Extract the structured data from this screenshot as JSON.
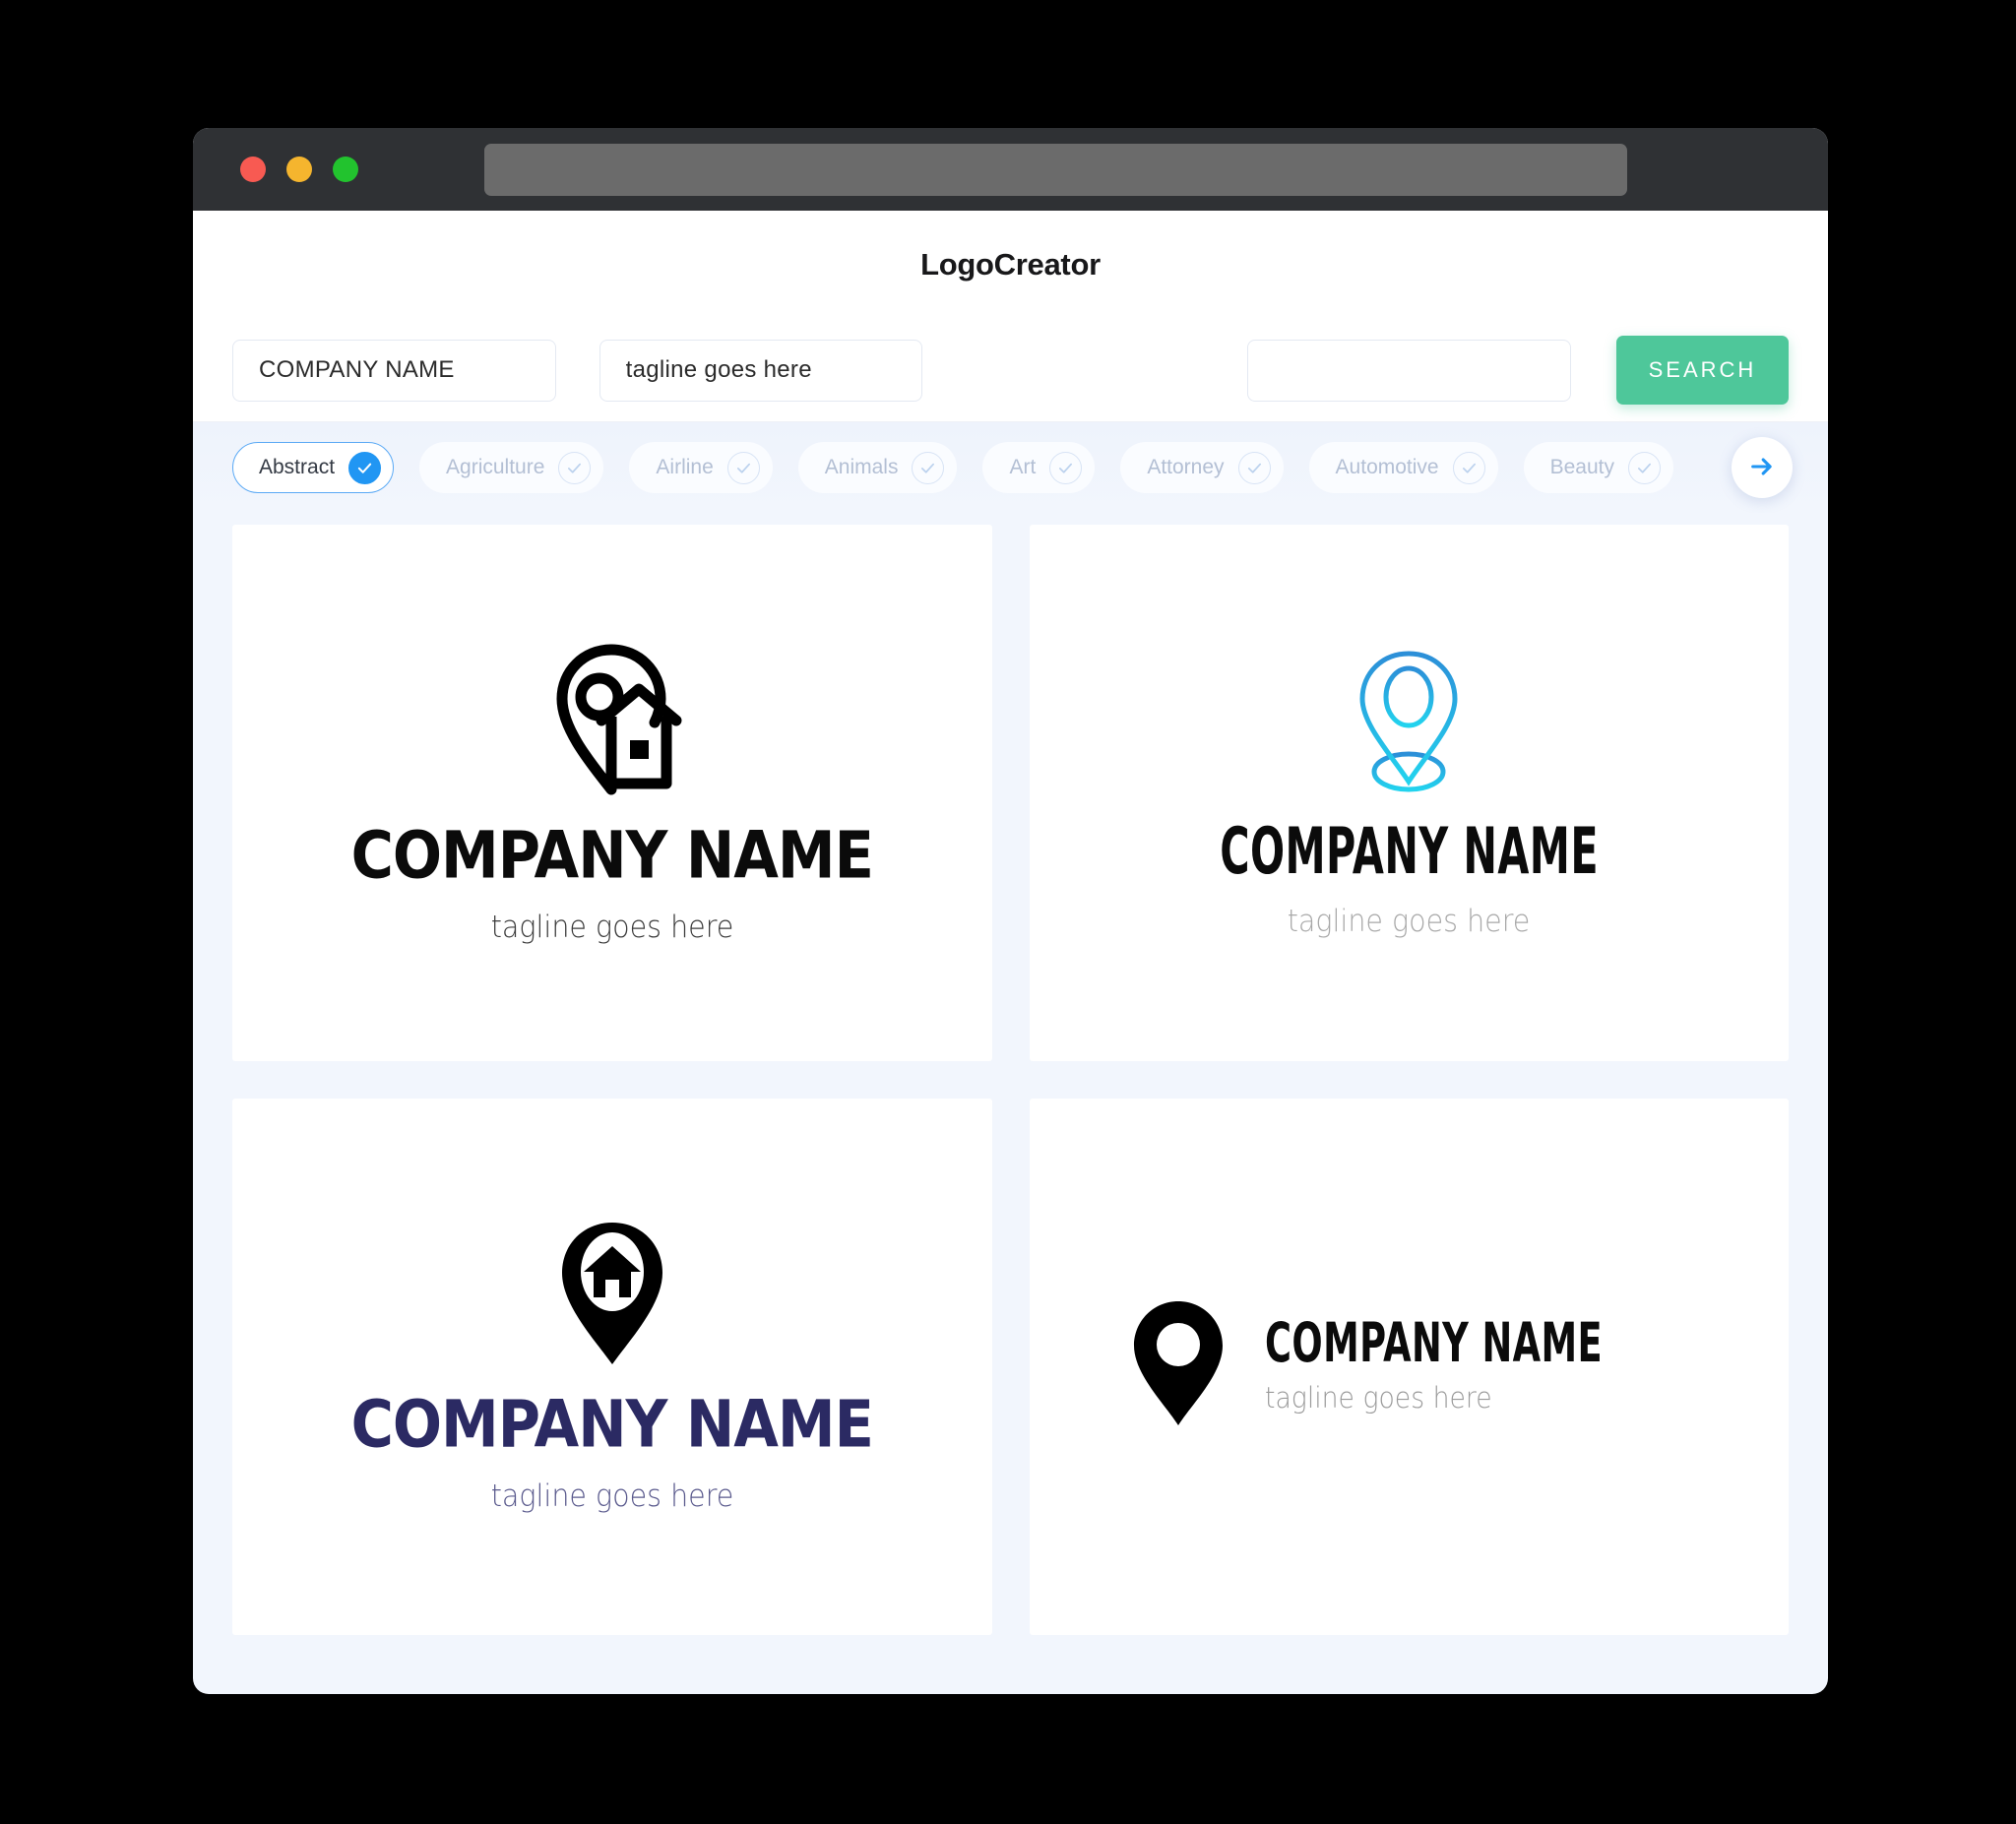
{
  "window": {
    "traffic_lights": [
      {
        "name": "close",
        "color": "#f85a52"
      },
      {
        "name": "minimize",
        "color": "#f5b52e"
      },
      {
        "name": "maximize",
        "color": "#22c32e"
      }
    ],
    "address_bar_value": ""
  },
  "header": {
    "title": "LogoCreator"
  },
  "search": {
    "company_value": "COMPANY NAME",
    "tagline_value": "tagline goes here",
    "extra_value": "",
    "search_label": "SEARCH",
    "search_button_color": "#4ec79a"
  },
  "categories": {
    "next_icon": "arrow-right-icon",
    "accent_color": "#2196f3",
    "items": [
      {
        "label": "Abstract",
        "selected": true
      },
      {
        "label": "Agriculture",
        "selected": false
      },
      {
        "label": "Airline",
        "selected": false
      },
      {
        "label": "Animals",
        "selected": false
      },
      {
        "label": "Art",
        "selected": false
      },
      {
        "label": "Attorney",
        "selected": false
      },
      {
        "label": "Automotive",
        "selected": false
      },
      {
        "label": "Beauty",
        "selected": false
      }
    ]
  },
  "results": [
    {
      "icon": "map-pin-house-outline-icon",
      "company": "COMPANY NAME",
      "tagline": "tagline goes here",
      "company_color": "#0b0b0b",
      "tagline_color": "#3b3b3b",
      "icon_color": "#000000",
      "layout": "stacked"
    },
    {
      "icon": "map-pin-outline-gradient-icon",
      "company": "COMPANY NAME",
      "tagline": "tagline goes here",
      "company_color": "#0b0b0b",
      "tagline_color": "#a8a8a8",
      "icon_color": "#29b6f6",
      "layout": "stacked"
    },
    {
      "icon": "map-pin-house-solid-icon",
      "company": "COMPANY NAME",
      "tagline": "tagline goes here",
      "company_color": "#2b2a63",
      "tagline_color": "#5a5a8d",
      "icon_color": "#000000",
      "layout": "stacked"
    },
    {
      "icon": "map-pin-solid-icon",
      "company": "COMPANY NAME",
      "tagline": "tagline goes here",
      "company_color": "#0b0b0b",
      "tagline_color": "#9a9a9a",
      "icon_color": "#000000",
      "layout": "inline"
    }
  ]
}
